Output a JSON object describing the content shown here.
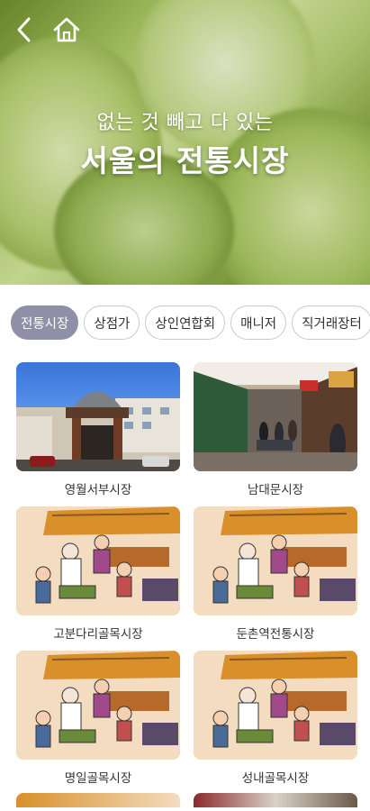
{
  "hero": {
    "subtitle": "없는 것 빼고 다 있는",
    "title": "서울의 전통시장"
  },
  "nav": {
    "back_icon": "chevron-left-icon",
    "home_icon": "home-icon"
  },
  "tabs": [
    {
      "label": "전통시장",
      "active": true
    },
    {
      "label": "상점가",
      "active": false
    },
    {
      "label": "상인연합회",
      "active": false
    },
    {
      "label": "매니저",
      "active": false
    },
    {
      "label": "직거래장터",
      "active": false
    }
  ],
  "markets": [
    {
      "name": "영월서부시장",
      "image": "photo-market-gate"
    },
    {
      "name": "남대문시장",
      "image": "photo-market-street"
    },
    {
      "name": "고분다리골목시장",
      "image": "illustration-market"
    },
    {
      "name": "둔촌역전통시장",
      "image": "illustration-market"
    },
    {
      "name": "명일골목시장",
      "image": "illustration-market"
    },
    {
      "name": "성내골목시장",
      "image": "illustration-market"
    }
  ],
  "colors": {
    "active_tab": "#8f8fa8",
    "tab_border": "#c9c9cf"
  }
}
